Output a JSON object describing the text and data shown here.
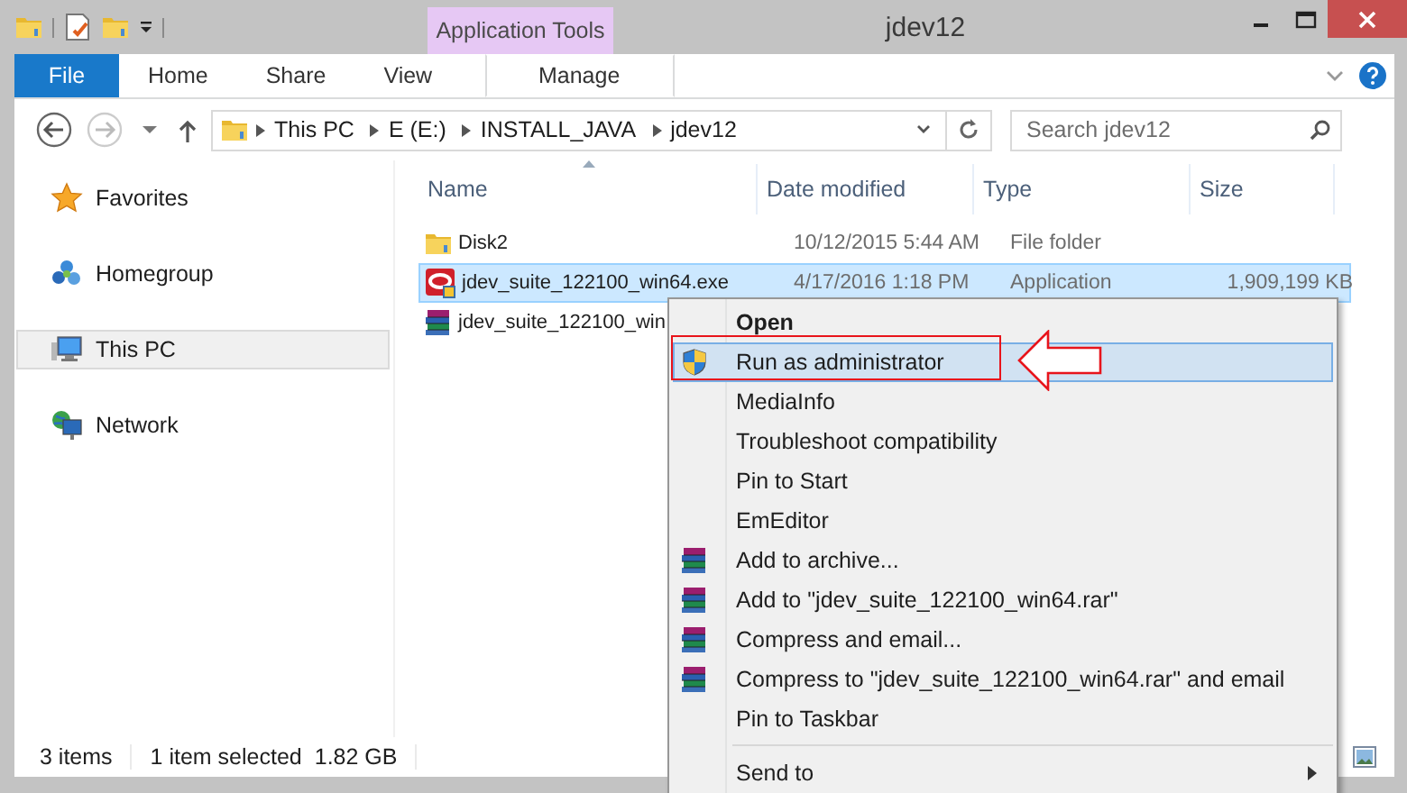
{
  "window": {
    "title": "jdev12",
    "context_tab": "Application Tools"
  },
  "ribbon": {
    "tabs": [
      {
        "label": "File",
        "kind": "file",
        "selected": false
      },
      {
        "label": "Home",
        "kind": "plain",
        "selected": false
      },
      {
        "label": "Share",
        "kind": "plain",
        "selected": false
      },
      {
        "label": "View",
        "kind": "plain",
        "selected": false
      },
      {
        "label": "Manage",
        "kind": "context",
        "selected": false
      }
    ]
  },
  "address": {
    "crumbs": [
      "This PC",
      "E (E:)",
      "INSTALL_JAVA",
      "jdev12"
    ],
    "search": {
      "placeholder": "Search jdev12"
    }
  },
  "nav": {
    "items": [
      {
        "label": "Favorites",
        "kind": "favorites",
        "selected": false
      },
      {
        "label": "Homegroup",
        "kind": "homegroup",
        "selected": false
      },
      {
        "label": "This PC",
        "kind": "computer",
        "selected": true
      },
      {
        "label": "Network",
        "kind": "network",
        "selected": false
      }
    ]
  },
  "files": {
    "columns": [
      "Name",
      "Date modified",
      "Type",
      "Size"
    ],
    "rows": [
      {
        "kind": "folder",
        "name": "Disk2",
        "date": "10/12/2015 5:44 AM",
        "type": "File folder",
        "selected": false
      },
      {
        "kind": "app",
        "name": "jdev_suite_122100_win64.exe",
        "date": "4/17/2016 1:18 PM",
        "type": "Application",
        "size": "1,909,199 KB",
        "selected": true
      },
      {
        "kind": "archive",
        "name": "jdev_suite_122100_win",
        "selected": false
      }
    ]
  },
  "context_menu": {
    "items": [
      {
        "label": "Open",
        "kind": "default",
        "selected": false
      },
      {
        "label": "Run as administrator",
        "kind": "shield",
        "selected": true
      },
      {
        "label": "MediaInfo",
        "kind": "plain",
        "selected": false
      },
      {
        "label": "Troubleshoot compatibility",
        "kind": "plain",
        "selected": false
      },
      {
        "label": "Pin to Start",
        "kind": "plain",
        "selected": false
      },
      {
        "label": "EmEditor",
        "kind": "plain",
        "selected": false
      },
      {
        "label": "Add to archive...",
        "kind": "archive",
        "selected": false
      },
      {
        "label": "Add to \"jdev_suite_122100_win64.rar\"",
        "kind": "archive",
        "selected": false
      },
      {
        "label": "Compress and email...",
        "kind": "archive",
        "selected": false
      },
      {
        "label": "Compress to \"jdev_suite_122100_win64.rar\" and email",
        "kind": "archive",
        "selected": false
      },
      {
        "label": "Pin to Taskbar",
        "kind": "plain",
        "selected": false
      },
      {
        "kind": "separator"
      },
      {
        "label": "Send to",
        "kind": "submenu",
        "selected": false
      }
    ]
  },
  "status_bar": {
    "count": "3 items",
    "selection": "1 item selected",
    "selection_size": "1.82 GB"
  }
}
